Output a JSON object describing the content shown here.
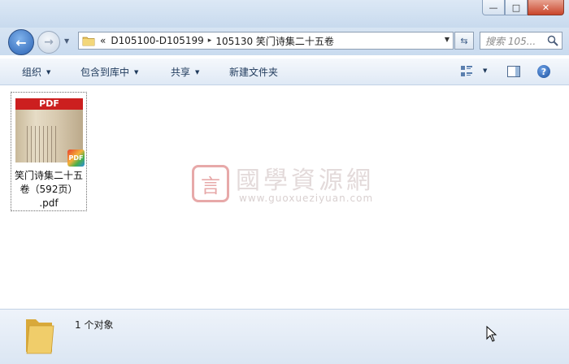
{
  "window": {
    "caption_buttons": {
      "minimize": "—",
      "maximize": "□",
      "close": "✕"
    }
  },
  "nav": {
    "back_icon": "back-arrow-icon",
    "forward_icon": "forward-arrow-icon",
    "address": {
      "prefix": "«",
      "segments": [
        "D105100-D105199",
        "105130 笑门诗集二十五卷"
      ],
      "separator": "▸"
    },
    "search_placeholder": "搜索 105..."
  },
  "toolbar": {
    "organize": "组织",
    "include_in_library": "包含到库中",
    "share": "共享",
    "new_folder": "新建文件夹",
    "help": "?"
  },
  "files": [
    {
      "thumb_label": "PDF",
      "badge": "PDF",
      "name_line1": "笑门诗集二十五",
      "name_line2": "卷（592页）",
      "name_line3": ".pdf"
    }
  ],
  "watermark": {
    "logo_char": "言",
    "title": "國學資源網",
    "url": "www.guoxueziyuan.com"
  },
  "status": {
    "count_text": "1 个对象"
  },
  "colors": {
    "accent": "#2a62b3",
    "pdf_red": "#cc1f1f",
    "watermark": "#e7a9a9"
  }
}
